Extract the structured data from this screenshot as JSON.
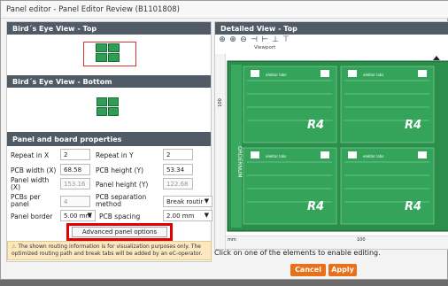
{
  "window": {
    "title": "Panel editor - Panel Editor Review (B1101808)"
  },
  "birds_eye_top": {
    "header": "Bird´s Eye View - Top"
  },
  "birds_eye_bottom": {
    "header": "Bird´s Eye View - Bottom"
  },
  "props": {
    "header": "Panel and board properties",
    "repeat_x_label": "Repeat in X",
    "repeat_x_value": "2",
    "repeat_y_label": "Repeat in Y",
    "repeat_y_value": "2",
    "pcb_width_label": "PCB width (X)",
    "pcb_width_value": "68.58",
    "pcb_height_label": "PCB height (Y)",
    "pcb_height_value": "53.34",
    "panel_width_label": "Panel width (X)",
    "panel_width_value": "153.16",
    "panel_height_label": "Panel height (Y)",
    "panel_height_value": "122.68",
    "pcbs_per_panel_label": "PCBs per panel",
    "pcbs_per_panel_value": "4",
    "separation_label": "PCB separation method",
    "separation_value": "Break routir",
    "panel_border_label": "Panel border",
    "panel_border_value": "5.00 mm",
    "pcb_spacing_label": "PCB spacing",
    "pcb_spacing_value": "2.00 mm",
    "advanced_button": "Advanced panel options"
  },
  "note": {
    "line1": "The shown routing information is for visualization purposes only. The",
    "line2": "optimized routing path and break tabs will be added by an eC-operator."
  },
  "detailed": {
    "header": "Detailed View - Top",
    "viewport_label": "Viewport",
    "ruler_v_label": "100",
    "ruler_h_mm": "mm",
    "ruler_h_100": "100",
    "side_text": "ORDERNUM",
    "board_text": "R4",
    "brand_text": "elektor labs"
  },
  "status_text": "Click on one of the elements to enable editing.",
  "buttons": {
    "cancel": "Cancel",
    "apply": "Apply"
  },
  "colors": {
    "header_bg": "#505b66",
    "pcb_green": "#2f9e55",
    "accent_orange": "#e8701a",
    "highlight_red": "#e00000"
  }
}
